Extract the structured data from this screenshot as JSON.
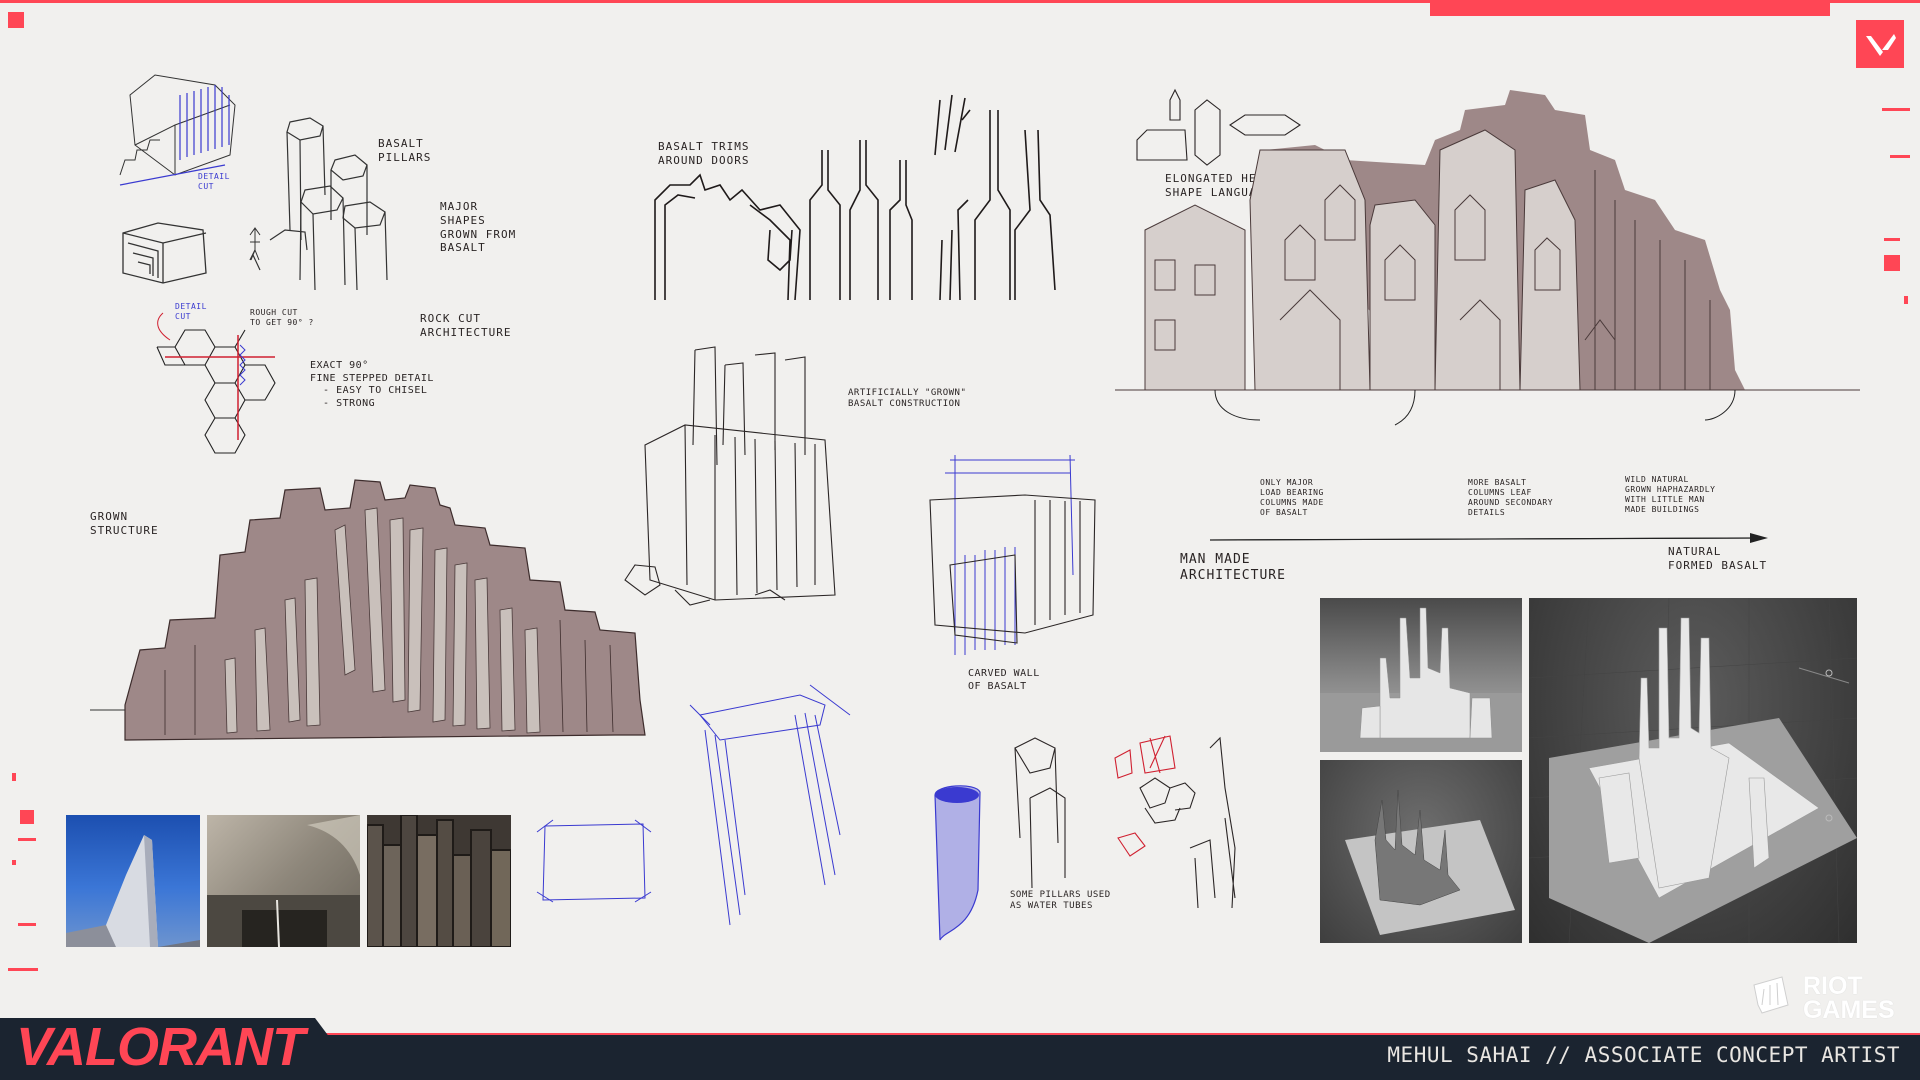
{
  "brand": {
    "logo": "VALORANT",
    "publisher_line1": "RIOT",
    "publisher_line2": "GAMES",
    "accent": "#ff4655",
    "footer_bg": "#1b2430",
    "corner_icon": "valorant-v-icon"
  },
  "credit": "MEHUL SAHAI // ASSOCIATE CONCEPT ARTIST",
  "notes": {
    "detail_cut_top": "DETAIL\nCUT",
    "basalt_pillars": "BASALT\nPILLARS",
    "major_shapes": "MAJOR\nSHAPES\nGROWN FROM\nBASALT",
    "detail_cut_left": "DETAIL\nCUT",
    "rough_cut": "ROUGH CUT\nTO GET 90° ?",
    "rock_cut": "ROCK CUT\nARCHITECTURE",
    "exact_90": "EXACT 90°\nFINE STEPPED DETAIL\n  - EASY TO CHISEL\n  - STRONG",
    "grown_structure": "GROWN\nSTRUCTURE",
    "basalt_trims": "BASALT TRIMS\nAROUND DOORS",
    "artificially_grown": "ARTIFICIALLY \"GROWN\"\nBASALT CONSTRUCTION",
    "carved_wall": "CARVED WALL\nOF BASALT",
    "water_tubes": "SOME PILLARS USED\nAS WATER TUBES",
    "hex_shape": "ELONGATED HEX\nSHAPE LANGUAGE",
    "note_only_major": "ONLY MAJOR\nLOAD BEARING\nCOLUMNS MADE\nOF BASALT",
    "note_more_basalt": "MORE BASALT\nCOLUMNS LEAF\nAROUND SECONDARY\nDETAILS",
    "note_wild_natural": "WILD NATURAL\nGROWN HAPHAZARDLY\nWITH LITTLE MAN\nMADE BUILDINGS",
    "man_made": "MAN MADE\nARCHITECTURE",
    "naturally_formed": "NATURAL\nFORMED BASALT"
  },
  "reference_photos": [
    "church-tower-photo",
    "concrete-wall-photo",
    "basalt-columns-photo"
  ],
  "render_panels": [
    "blockout-render-sky",
    "blockout-render-dark",
    "blockout-render-large"
  ]
}
